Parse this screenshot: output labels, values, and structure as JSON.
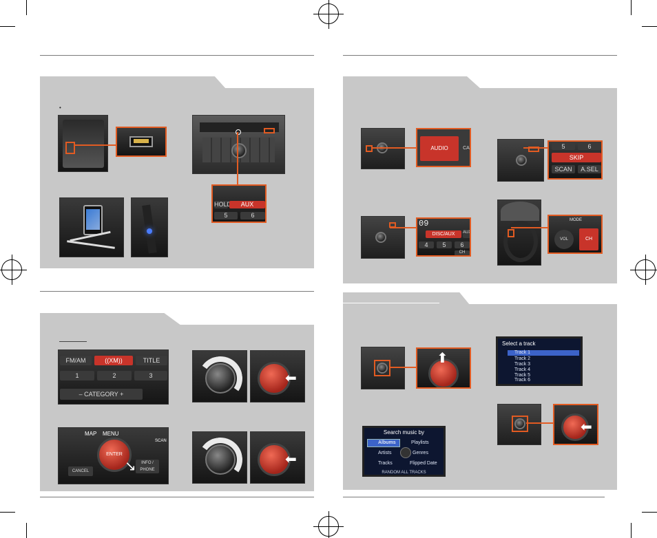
{
  "caption": "•",
  "usb_box": {
    "aux_label": "AUX"
  },
  "headunit": {
    "hold_label": "HOLD",
    "aux_label": "AUX",
    "num_5": "5",
    "num_6": "6"
  },
  "audio_box": {
    "label": "AUDIO",
    "side_label": "CA"
  },
  "skip_box": {
    "num_5": "5",
    "num_6": "6",
    "skip": "SKIP",
    "scan": "SCAN",
    "asel": "A.SEL"
  },
  "disc_box": {
    "display": "09",
    "label": "DISC/AUX",
    "side": "AUX",
    "num_4": "4",
    "num_5": "5",
    "num_6": "6",
    "bottom": "CH"
  },
  "steering_box": {
    "mode": "MODE",
    "vol": "VOL",
    "ch": "CH"
  },
  "xm_box": {
    "fmam": "FM/AM",
    "xm": "((XM))",
    "title": "TITLE",
    "num_1": "1",
    "num_2": "2",
    "num_3": "3",
    "category": "– CATEGORY +"
  },
  "knob_labels": {
    "enter": "ENTER",
    "map": "MAP",
    "menu": "MENU",
    "cancel": "CANCEL",
    "info": "INFO / PHONE",
    "scan": "SCAN"
  },
  "track_screen": {
    "title": "Select a track",
    "tracks": [
      "Track 1",
      "Track 2",
      "Track 3",
      "Track 4",
      "Track 5",
      "Track 6"
    ]
  },
  "search_screen": {
    "title": "Search music by",
    "items": [
      "Albums",
      "Playlists",
      "Artists",
      "Genres",
      "Tracks",
      "Flipped Date"
    ],
    "footer": "RANDOM ALL TRACKS"
  },
  "colors": {
    "accent": "#e25b22",
    "panel": "#c8c8c8",
    "red_button": "#c8342a",
    "screen_bg": "#0d1630"
  }
}
